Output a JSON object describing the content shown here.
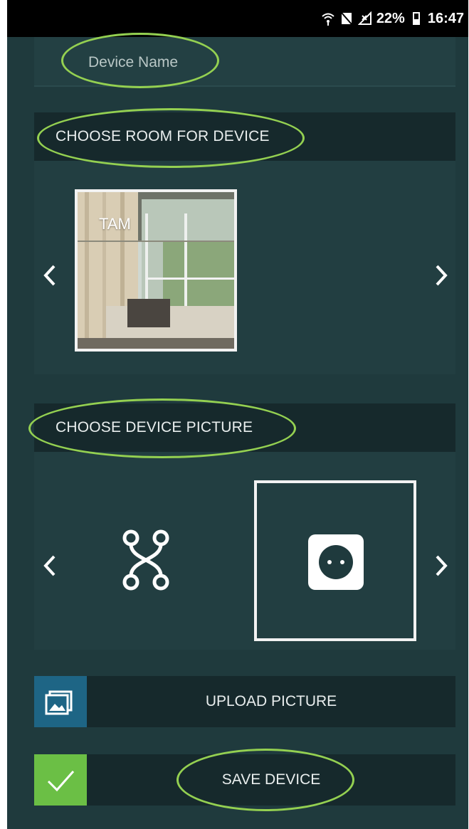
{
  "status_bar": {
    "battery": "22%",
    "time": "16:47",
    "icons": [
      "wifi-icon",
      "no-sim-icon",
      "signal-icon",
      "battery-icon"
    ]
  },
  "device_name": {
    "placeholder": "Device Name"
  },
  "room_section": {
    "title": "CHOOSE ROOM FOR DEVICE",
    "rooms": [
      {
        "label": "TAM",
        "selected": true
      }
    ],
    "prev_icon": "chevron-left-icon",
    "next_icon": "chevron-right-icon"
  },
  "picture_section": {
    "title": "CHOOSE DEVICE PICTURE",
    "options": [
      {
        "icon": "network-node-icon",
        "selected": false
      },
      {
        "icon": "power-socket-icon",
        "selected": true
      }
    ],
    "prev_icon": "chevron-left-icon",
    "next_icon": "chevron-right-icon"
  },
  "upload": {
    "label": "UPLOAD PICTURE",
    "icon": "image-gallery-icon"
  },
  "save": {
    "label": "SAVE DEVICE",
    "icon": "checkmark-icon"
  },
  "colors": {
    "background": "#1f3a3d",
    "header": "#16292c",
    "upload_accent": "#1e6585",
    "save_accent": "#6bbf45",
    "annotation": "#94d051"
  }
}
